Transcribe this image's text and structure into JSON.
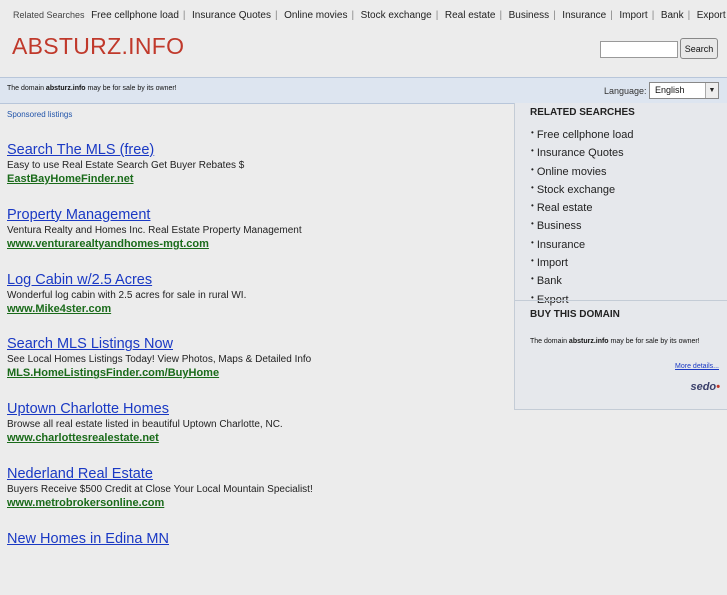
{
  "related_bar": {
    "label": "Related Searches",
    "items": [
      "Free cellphone load",
      "Insurance Quotes",
      "Online movies",
      "Stock exchange",
      "Real estate",
      "Business",
      "Insurance",
      "Import",
      "Bank",
      "Export"
    ]
  },
  "header": {
    "logo": "ABSTURZ.INFO",
    "search_placeholder": "",
    "search_button": "Search"
  },
  "domain_bar": {
    "prefix": "The domain ",
    "domain": "absturz.info",
    "suffix": " may be for sale by its owner!",
    "language_label": "Language:",
    "language_value": "English"
  },
  "sponsored_label": "Sponsored listings",
  "listings": [
    {
      "title": "Search The MLS (free)",
      "desc": "Easy to use Real Estate Search Get Buyer Rebates $",
      "url": "EastBayHomeFinder.net"
    },
    {
      "title": "Property Management",
      "desc": "Ventura Realty and Homes Inc. Real Estate Property Management",
      "url": "www.venturarealtyandhomes-mgt.com"
    },
    {
      "title": "Log Cabin w/2.5 Acres",
      "desc": "Wonderful log cabin with 2.5 acres for sale in rural WI.",
      "url": "www.Mike4ster.com"
    },
    {
      "title": "Search MLS Listings Now",
      "desc": "See Local Homes Listings Today! View Photos, Maps & Detailed Info",
      "url": "MLS.HomeListingsFinder.com/BuyHome"
    },
    {
      "title": "Uptown Charlotte Homes",
      "desc": "Browse all real estate listed in beautiful Uptown Charlotte, NC.",
      "url": "www.charlottesrealestate.net"
    },
    {
      "title": "Nederland Real Estate",
      "desc": "Buyers Receive $500 Credit at Close Your Local Mountain Specialist!",
      "url": "www.metrobrokersonline.com"
    },
    {
      "title": "New Homes in Edina MN",
      "desc": "",
      "url": ""
    }
  ],
  "sidebar": {
    "related_title": "RELATED SEARCHES",
    "related_items": [
      "Free cellphone load",
      "Insurance Quotes",
      "Online movies",
      "Stock exchange",
      "Real estate",
      "Business",
      "Insurance",
      "Import",
      "Bank",
      "Export"
    ],
    "buy_title": "BUY THIS DOMAIN",
    "buy_prefix": "The domain ",
    "buy_domain": "absturz.info",
    "buy_suffix": " may be for sale by its owner!",
    "more_details": "More details...",
    "sedo_logo": "sedo"
  },
  "colors": {
    "logo": "#c0392b",
    "link": "#1a39c4",
    "url": "#1a6b1a",
    "domain_bar_bg": "#dde5f0"
  }
}
